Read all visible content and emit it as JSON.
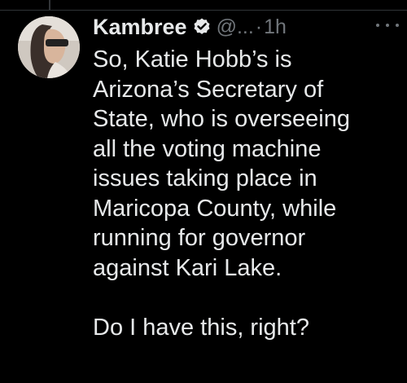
{
  "tweet": {
    "display_name": "Kambree",
    "handle": "@...",
    "separator": "·",
    "timestamp": "1h",
    "verified_icon": "verified-badge-icon",
    "more_icon": "more-options-icon",
    "lines": [
      "So, Katie Hobb’s is",
      "Arizona’s Secretary of",
      "State, who is overseeing",
      "all the voting machine",
      "issues taking place in",
      "Maricopa County, while",
      "running for governor",
      "against Kari Lake."
    ],
    "closing_line": "Do I have this, right?"
  },
  "colors": {
    "background": "#000000",
    "text": "#e7e9ea",
    "secondary": "#71767b",
    "divider": "#2f3336"
  }
}
